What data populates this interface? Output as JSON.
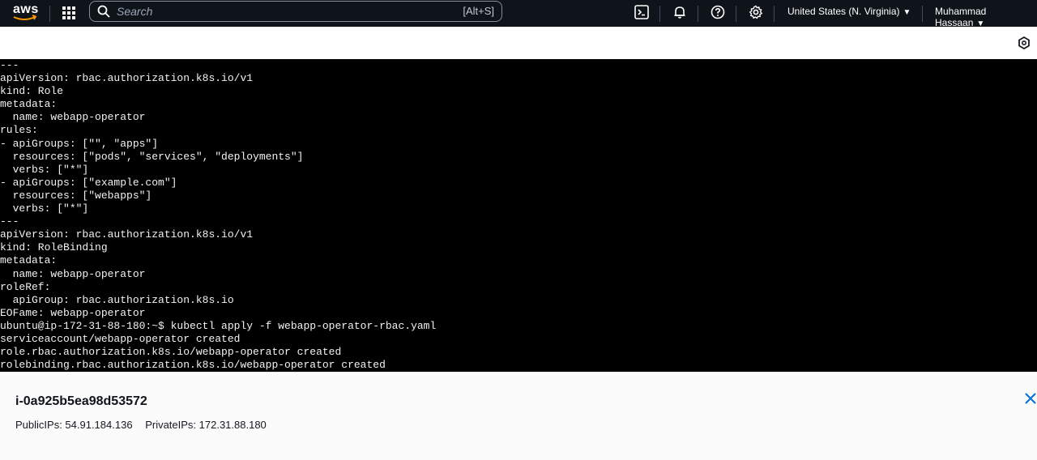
{
  "topnav": {
    "logo_text": "aws",
    "search": {
      "placeholder": "Search",
      "shortcut": "[Alt+S]"
    },
    "region": "United States (N. Virginia)",
    "user": "Muhammad Hassaan"
  },
  "terminal": {
    "lines": [
      "---",
      "apiVersion: rbac.authorization.k8s.io/v1",
      "kind: Role",
      "metadata:",
      "  name: webapp-operator",
      "rules:",
      "- apiGroups: [\"\", \"apps\"]",
      "  resources: [\"pods\", \"services\", \"deployments\"]",
      "  verbs: [\"*\"]",
      "- apiGroups: [\"example.com\"]",
      "  resources: [\"webapps\"]",
      "  verbs: [\"*\"]",
      "---",
      "apiVersion: rbac.authorization.k8s.io/v1",
      "kind: RoleBinding",
      "metadata:",
      "  name: webapp-operator",
      "roleRef:",
      "  apiGroup: rbac.authorization.k8s.io",
      "EOFame: webapp-operator",
      "ubuntu@ip-172-31-88-180:~$ kubectl apply -f webapp-operator-rbac.yaml",
      "serviceaccount/webapp-operator created",
      "role.rbac.authorization.k8s.io/webapp-operator created",
      "rolebinding.rbac.authorization.k8s.io/webapp-operator created"
    ]
  },
  "instance": {
    "id": "i-0a925b5ea98d53572",
    "public_ips": "PublicIPs: 54.91.184.136",
    "private_ips": "PrivateIPs: 172.31.88.180"
  },
  "icons": {
    "apps": "apps-grid-icon",
    "search": "search-icon",
    "cloudshell": "cloudshell-icon",
    "notifications": "bell-icon",
    "help": "help-icon",
    "settings": "gear-icon",
    "toolbar": "hexagon-settings-icon",
    "close": "close-icon"
  },
  "colors": {
    "nav_bg": "#0f141a",
    "terminal_bg": "#000000",
    "accent": "#0972d3"
  }
}
